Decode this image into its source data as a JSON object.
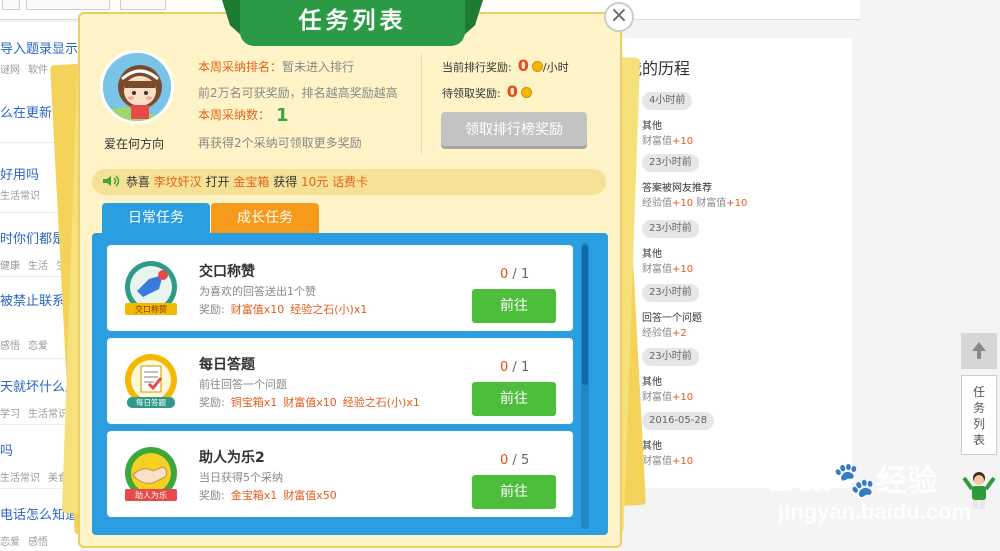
{
  "background": {
    "left_items": [
      {
        "title": "导入题录显示",
        "tags": [
          "谜网",
          "软件"
        ]
      },
      {
        "title": "么在更新的时",
        "tags": []
      },
      {
        "title": "好用吗",
        "tags": [
          "生活常识"
        ]
      },
      {
        "title": "时你们都是怎",
        "tags": [
          "健康",
          "生活",
          "生"
        ]
      },
      {
        "title": "被禁止联系了",
        "tags": [
          "感悟",
          "恋爱"
        ]
      },
      {
        "title": "天就坏什么原",
        "tags": [
          "学习",
          "生活常识"
        ]
      },
      {
        "title": "吗",
        "tags": [
          "生活常识",
          "美食"
        ]
      },
      {
        "title": "电话怎么知道",
        "tags": [
          "恋爱",
          "感悟"
        ]
      }
    ],
    "history": {
      "title": "我的历程",
      "entries": [
        {
          "time": "4小时前",
          "category": "其他",
          "rewards": [
            {
              "label": "财富值",
              "value": "+10"
            }
          ]
        },
        {
          "time": "23小时前",
          "category": "答案被网友推荐",
          "rewards": [
            {
              "label": "经验值",
              "value": "+10"
            },
            {
              "label": "财富值",
              "value": "+10"
            }
          ]
        },
        {
          "time": "23小时前",
          "category": "其他",
          "rewards": [
            {
              "label": "财富值",
              "value": "+10"
            }
          ]
        },
        {
          "time": "23小时前",
          "category": "回答一个问题",
          "rewards": [
            {
              "label": "经验值",
              "value": "+2"
            }
          ]
        },
        {
          "time": "23小时前",
          "category": "其他",
          "rewards": [
            {
              "label": "财富值",
              "value": "+10"
            }
          ]
        },
        {
          "time": "2016-05-28",
          "category": "其他",
          "rewards": [
            {
              "label": "财富值",
              "value": "+10"
            }
          ]
        }
      ]
    },
    "side_buttons": {
      "task_list_label": "任务列表"
    },
    "watermark": {
      "logo": "Bai",
      "logo_cn": "经验",
      "url": "jingyan.baidu.com"
    }
  },
  "dialog": {
    "title": "任务列表",
    "close_symbol": "×",
    "user": {
      "name": "爱在何方向"
    },
    "weekly": {
      "rank_label": "本周采纳排名：",
      "rank_value": "暂未进入排行",
      "rank_hint": "前2万名可获奖励，排名越高奖励越高",
      "count_label": "本周采纳数：",
      "count_value": "1",
      "more_hint": "再获得2个采纳可领取更多奖励"
    },
    "rewards": {
      "current_label": "当前排行奖励:",
      "current_value": "0",
      "current_unit": "/小时",
      "pending_label": "待领取奖励:",
      "pending_value": "0",
      "claim_button": "领取排行榜奖励"
    },
    "notice": {
      "prefix": "恭喜",
      "user": "李坟奸汉",
      "action": "打开",
      "item": "金宝箱",
      "verb": "获得",
      "prize": "10元 话费卡"
    },
    "tabs": [
      "日常任务",
      "成长任务"
    ],
    "tasks": [
      {
        "title": "交口称赞",
        "desc": "为喜欢的回答送出1个赞",
        "reward_label": "奖励:",
        "rewards": [
          "财富值x10",
          "经验之石(小)x1"
        ],
        "progress_current": "0",
        "progress_total": "1",
        "button": "前往",
        "badge_text": "交口称赞"
      },
      {
        "title": "每日答题",
        "desc": "前往回答一个问题",
        "reward_label": "奖励:",
        "rewards": [
          "铜宝箱x1",
          "财富值x10",
          "经验之石(小)x1"
        ],
        "progress_current": "0",
        "progress_total": "1",
        "button": "前往",
        "badge_text": "每日答题"
      },
      {
        "title": "助人为乐2",
        "desc": "当日获得5个采纳",
        "reward_label": "奖励:",
        "rewards": [
          "金宝箱x1",
          "财富值x50"
        ],
        "progress_current": "0",
        "progress_total": "5",
        "button": "前往",
        "badge_text": "助人为乐"
      }
    ]
  },
  "colors": {
    "ribbon_green": "#2a9a44",
    "dialog_bg": "#fff4c7",
    "panel_blue": "#2a9ee0",
    "tab_orange": "#f59a1a",
    "go_green": "#4cbe3c",
    "accent_orange": "#e8621c"
  }
}
